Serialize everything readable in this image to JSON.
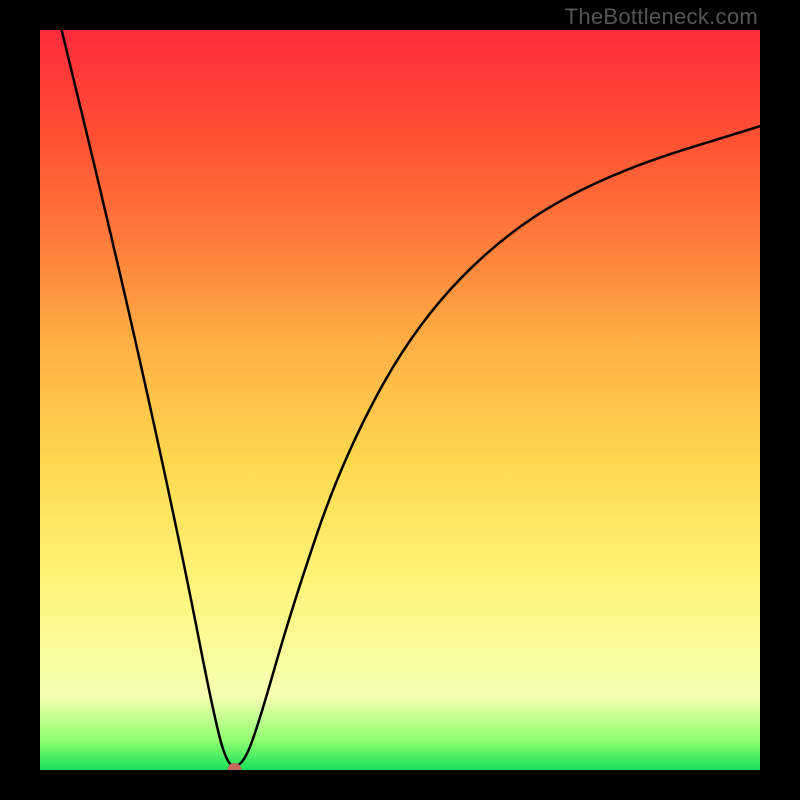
{
  "watermark": "TheBottleneck.com",
  "chart_data": {
    "type": "line",
    "title": "",
    "xlabel": "",
    "ylabel": "",
    "xlim": [
      0,
      100
    ],
    "ylim": [
      0,
      100
    ],
    "marker": {
      "x": 27,
      "y": 0,
      "color": "#c46b5d"
    },
    "series": [
      {
        "name": "curve",
        "points": [
          {
            "x": 3,
            "y": 100
          },
          {
            "x": 8,
            "y": 80
          },
          {
            "x": 14,
            "y": 55
          },
          {
            "x": 20,
            "y": 28
          },
          {
            "x": 24,
            "y": 8
          },
          {
            "x": 26,
            "y": 0.5
          },
          {
            "x": 28,
            "y": 0.5
          },
          {
            "x": 30,
            "y": 5
          },
          {
            "x": 35,
            "y": 22
          },
          {
            "x": 42,
            "y": 42
          },
          {
            "x": 52,
            "y": 60
          },
          {
            "x": 65,
            "y": 73
          },
          {
            "x": 80,
            "y": 81
          },
          {
            "x": 100,
            "y": 87
          }
        ]
      }
    ],
    "background_gradient": {
      "top": "#ff2b3b",
      "bottom": "#16e05c"
    }
  }
}
